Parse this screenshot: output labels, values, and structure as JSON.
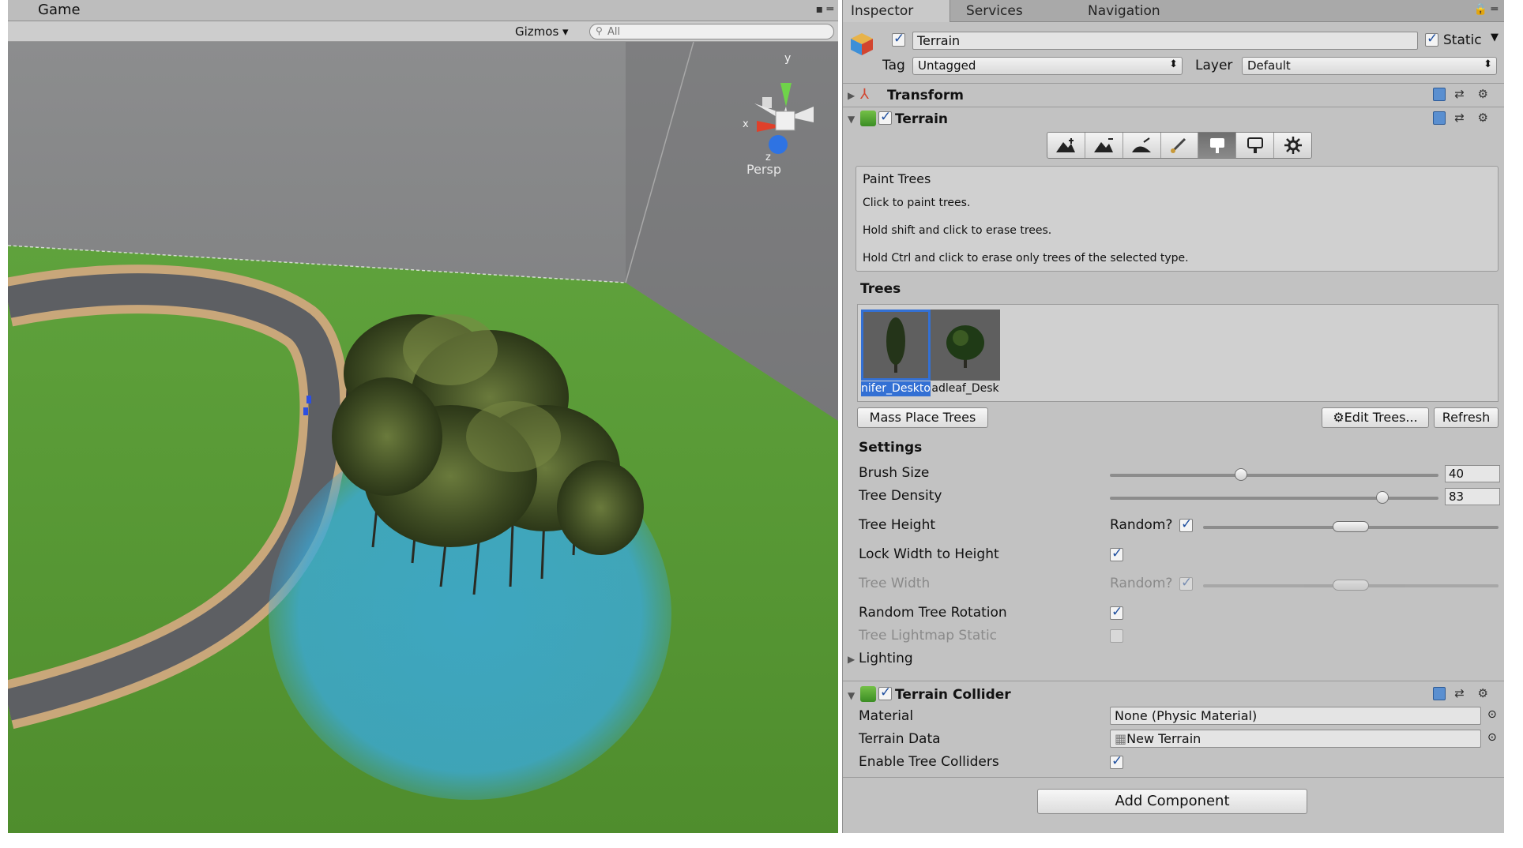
{
  "scene": {
    "tab_label": "Game",
    "tab_menu": "▪ ═",
    "gizmos_label": "Gizmos ▾",
    "search_placeholder": "All",
    "projection_label": "Persp",
    "axes": {
      "x": "x",
      "y": "y",
      "z": "z"
    }
  },
  "inspector": {
    "tabs": [
      "Inspector",
      "Services",
      "Navigation"
    ],
    "tab_menu": "🔒 ═",
    "object": {
      "name": "Terrain",
      "active": true,
      "static_label": "Static",
      "static": true,
      "tag_label": "Tag",
      "tag_value": "Untagged",
      "layer_label": "Layer",
      "layer_value": "Default"
    },
    "components": {
      "transform": {
        "title": "Transform"
      },
      "terrain": {
        "title": "Terrain",
        "enabled": true,
        "tools": [
          "raise-lower-icon",
          "paint-height-icon",
          "smooth-height-icon",
          "paint-texture-icon",
          "place-trees-icon",
          "paint-details-icon",
          "settings-icon"
        ],
        "active_tool_index": 4,
        "help": {
          "title": "Paint Trees",
          "line1": "Click to paint trees.",
          "line2": "Hold shift and click to erase trees.",
          "line3": "Hold Ctrl and click to erase only trees of the selected type."
        },
        "trees_header": "Trees",
        "trees": [
          {
            "name": "nifer_Desktop",
            "selected": true
          },
          {
            "name": "adleaf_Desk",
            "selected": false
          }
        ],
        "mass_place_label": "Mass Place Trees",
        "edit_trees_label": "Edit Trees...",
        "refresh_label": "Refresh",
        "settings_header": "Settings",
        "brush_size_label": "Brush Size",
        "brush_size_value": "40",
        "brush_size_fraction": 0.4,
        "tree_density_label": "Tree Density",
        "tree_density_value": "83",
        "tree_density_fraction": 0.83,
        "tree_height_label": "Tree Height",
        "random_label": "Random?",
        "tree_height_random": true,
        "lock_width_label": "Lock Width to Height",
        "lock_width": true,
        "tree_width_label": "Tree Width",
        "tree_width_random": true,
        "random_rotation_label": "Random Tree Rotation",
        "random_rotation": true,
        "lightmap_static_label": "Tree Lightmap Static",
        "lightmap_static": false,
        "lighting_label": "Lighting"
      },
      "terrain_collider": {
        "title": "Terrain Collider",
        "enabled": true,
        "material_label": "Material",
        "material_value": "None (Physic Material)",
        "terrain_data_label": "Terrain Data",
        "terrain_data_value": "New Terrain",
        "enable_tree_colliders_label": "Enable Tree Colliders",
        "enable_tree_colliders": true
      }
    },
    "add_component_label": "Add Component"
  }
}
